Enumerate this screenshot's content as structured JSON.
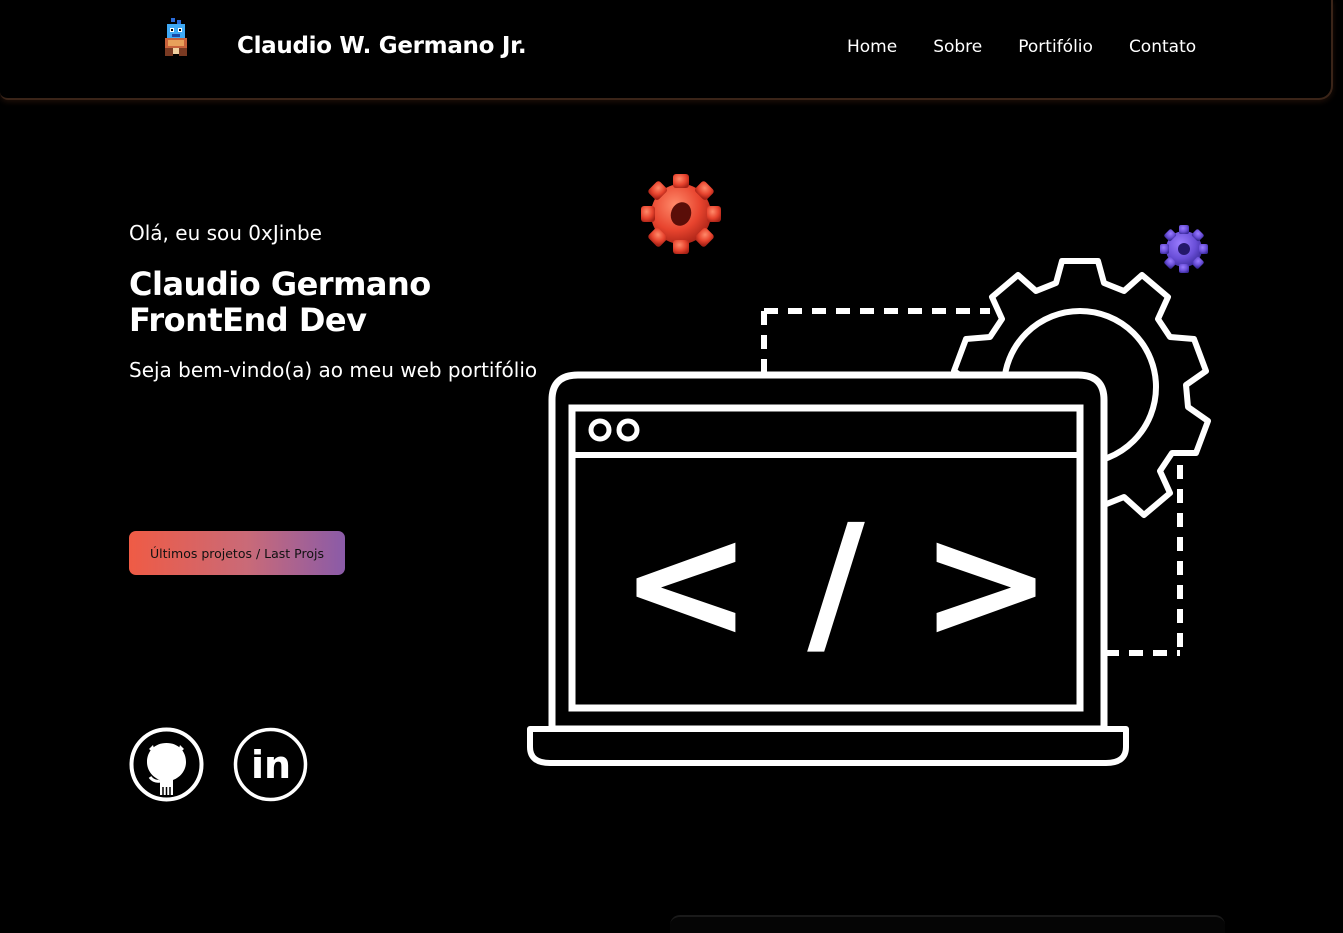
{
  "header": {
    "brand": "Claudio W. Germano Jr.",
    "nav": [
      {
        "label": "Home"
      },
      {
        "label": "Sobre"
      },
      {
        "label": "Portifólio"
      },
      {
        "label": "Contato"
      }
    ]
  },
  "hero": {
    "greeting": "Olá, eu sou 0xJinbe",
    "name_line1": "Claudio Germano",
    "name_line2": "FrontEnd Dev",
    "welcome": "Seja bem-vindo(a) ao meu web portifólio",
    "cta_label": "Últimos projetos / Last Projs",
    "code_symbol": "< / >"
  },
  "social": [
    {
      "icon": "github-icon"
    },
    {
      "icon": "linkedin-icon",
      "label": "in"
    }
  ],
  "colors": {
    "background": "#000000",
    "text": "#ffffff",
    "cta_start": "#ef5b45",
    "cta_end": "#8a5ba8",
    "gear_red": "#e84a3c",
    "gear_purple": "#6a4fd8"
  }
}
